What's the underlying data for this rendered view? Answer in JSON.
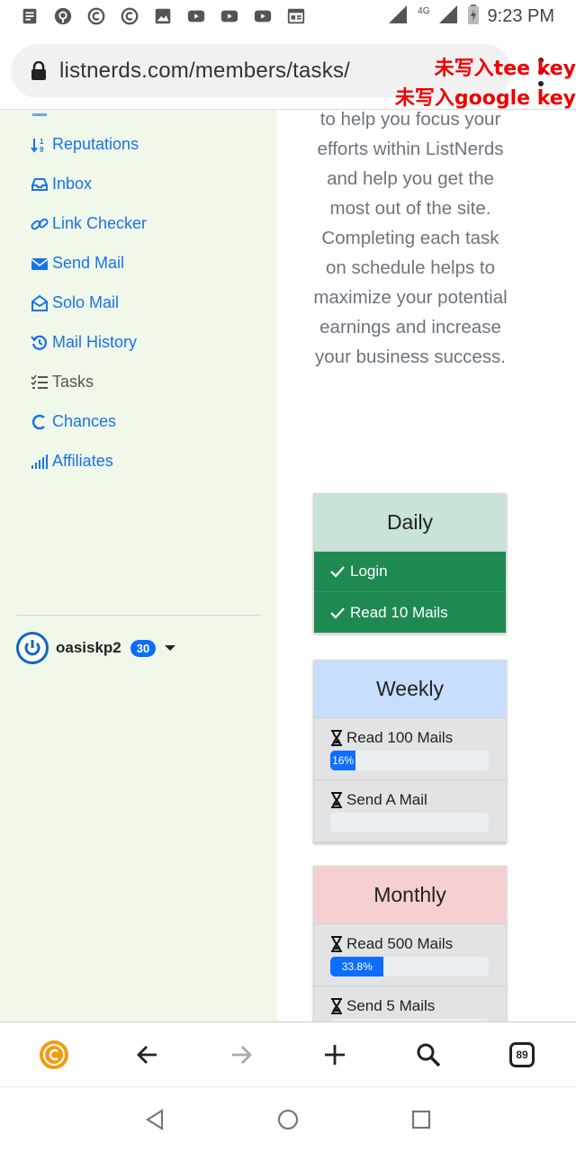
{
  "status_bar": {
    "time": "9:23 PM",
    "network": "4G",
    "icons": [
      "notes-icon",
      "podcast-icon",
      "coin-c-icon",
      "coin-c-icon",
      "gallery-icon",
      "youtube-icon",
      "youtube-icon",
      "youtube-icon",
      "newspaper-icon"
    ]
  },
  "browser": {
    "url": "listnerds.com/members/tasks/",
    "overlay_line1": "未写入tee key",
    "overlay_line2": "未写入google key",
    "tab_count": "89"
  },
  "sidebar": {
    "items": [
      {
        "label": "Reputations",
        "icon": "sort-numeric-icon",
        "active": false
      },
      {
        "label": "Inbox",
        "icon": "inbox-icon",
        "active": false
      },
      {
        "label": "Link Checker",
        "icon": "link-icon",
        "active": false
      },
      {
        "label": "Send Mail",
        "icon": "envelope-icon",
        "active": false
      },
      {
        "label": "Solo Mail",
        "icon": "envelope-open-icon",
        "active": false
      },
      {
        "label": "Mail History",
        "icon": "history-icon",
        "active": false
      },
      {
        "label": "Tasks",
        "icon": "checklist-icon",
        "active": true
      },
      {
        "label": "Chances",
        "icon": "c-icon",
        "active": false
      },
      {
        "label": "Affiliates",
        "icon": "bars-icon",
        "active": false
      }
    ],
    "user": {
      "name": "oasiskp2",
      "badge": "30"
    }
  },
  "main": {
    "intro_text": "to help you focus your efforts within ListNerds and help you get the most out of the site. Completing each task on schedule helps to maximize your potential earnings and increase your business success.",
    "daily": {
      "title": "Daily",
      "tasks": [
        "Login",
        "Read 10 Mails"
      ]
    },
    "weekly": {
      "title": "Weekly",
      "tasks": [
        {
          "label": "Read 100 Mails",
          "progress_label": "16%",
          "progress": 16
        },
        {
          "label": "Send A Mail",
          "progress_label": "",
          "progress": 0
        }
      ]
    },
    "monthly": {
      "title": "Monthly",
      "tasks": [
        {
          "label": "Read 500 Mails",
          "progress_label": "33.8%",
          "progress": 33.8
        },
        {
          "label": "Send 5 Mails",
          "progress_label": "",
          "progress": 0
        }
      ]
    }
  },
  "colors": {
    "link_blue": "#1a73e8",
    "sidebar_bg": "#f0f8ea",
    "success_green": "#1e8a52",
    "progress_blue": "#0d6efd",
    "accent_orange": "#f39c12"
  }
}
